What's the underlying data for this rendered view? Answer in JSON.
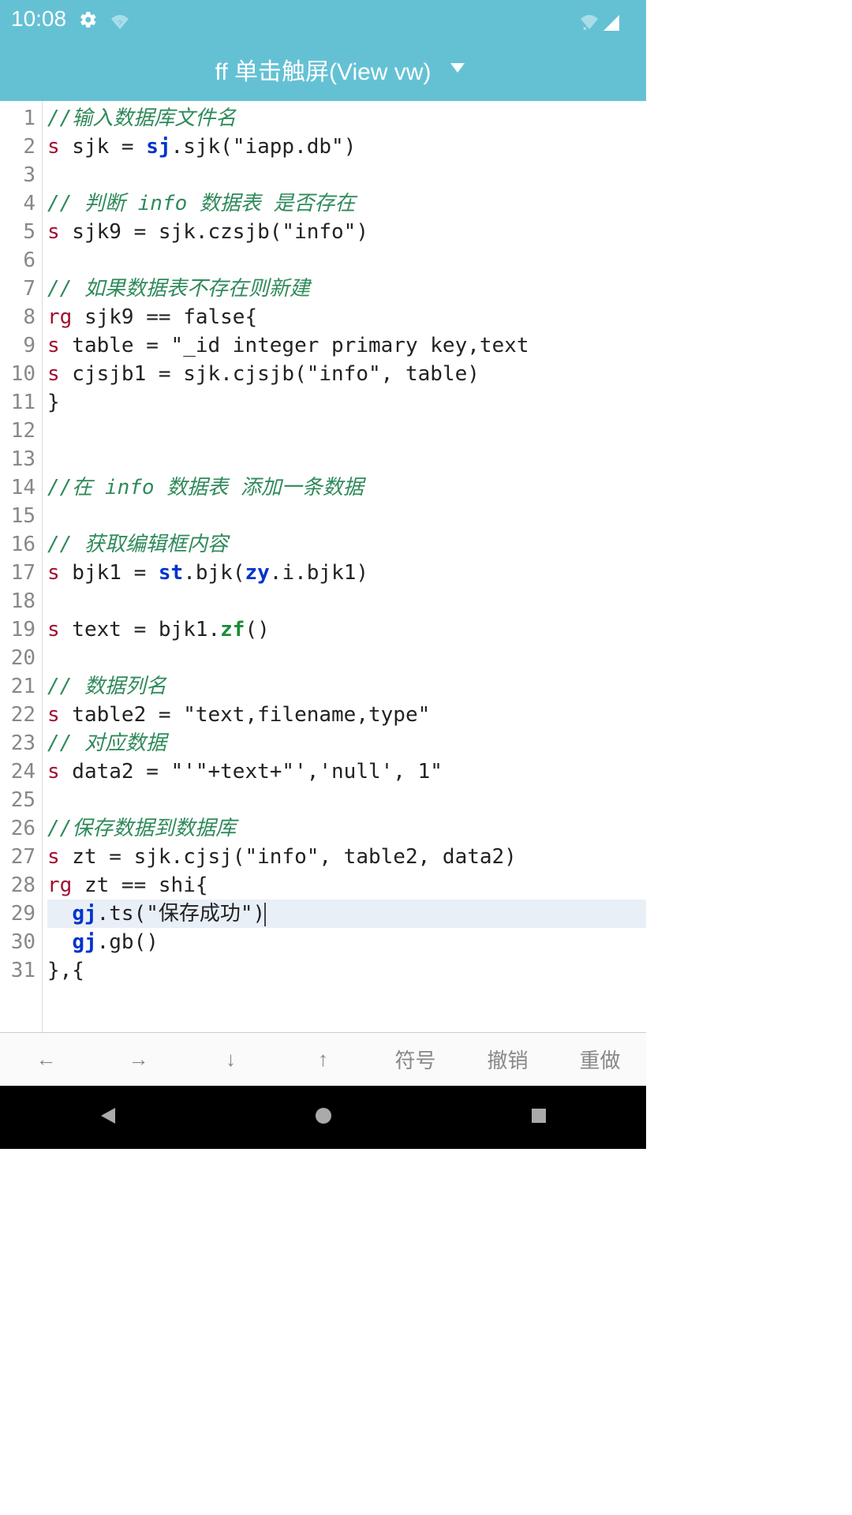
{
  "status": {
    "time": "10:08"
  },
  "header": {
    "title": "ff 单击触屏(View vw)"
  },
  "editor": {
    "lines": [
      {
        "n": "1",
        "segs": [
          {
            "t": "//输入数据库文件名",
            "c": "c-comment"
          }
        ]
      },
      {
        "n": "2",
        "segs": [
          {
            "t": "s",
            "c": "c-keyword"
          },
          {
            "t": " sjk = ",
            "c": "c-text"
          },
          {
            "t": "sj",
            "c": "c-builtin"
          },
          {
            "t": ".sjk(\"iapp.db\")",
            "c": "c-text"
          }
        ]
      },
      {
        "n": "3",
        "segs": []
      },
      {
        "n": "4",
        "segs": [
          {
            "t": "// 判断 info 数据表 是否存在",
            "c": "c-comment"
          }
        ]
      },
      {
        "n": "5",
        "segs": [
          {
            "t": "s",
            "c": "c-keyword"
          },
          {
            "t": " sjk9 = sjk.czsjb(\"info\")",
            "c": "c-text"
          }
        ]
      },
      {
        "n": "6",
        "segs": []
      },
      {
        "n": "7",
        "segs": [
          {
            "t": "// 如果数据表不存在则新建",
            "c": "c-comment"
          }
        ]
      },
      {
        "n": "8",
        "segs": [
          {
            "t": "rg",
            "c": "c-keyword"
          },
          {
            "t": " sjk9 == false{",
            "c": "c-text"
          }
        ]
      },
      {
        "n": "9",
        "segs": [
          {
            "t": "s",
            "c": "c-keyword"
          },
          {
            "t": " table = \"_id integer primary key,text",
            "c": "c-text"
          }
        ]
      },
      {
        "n": "10",
        "segs": [
          {
            "t": "s",
            "c": "c-keyword"
          },
          {
            "t": " cjsjb1 = sjk.cjsjb(\"info\", table)",
            "c": "c-text"
          }
        ]
      },
      {
        "n": "11",
        "segs": [
          {
            "t": "}",
            "c": "c-text"
          }
        ]
      },
      {
        "n": "12",
        "segs": []
      },
      {
        "n": "13",
        "segs": []
      },
      {
        "n": "14",
        "segs": [
          {
            "t": "//在 info 数据表 添加一条数据",
            "c": "c-comment"
          }
        ]
      },
      {
        "n": "15",
        "segs": []
      },
      {
        "n": "16",
        "segs": [
          {
            "t": "// 获取编辑框内容",
            "c": "c-comment"
          }
        ]
      },
      {
        "n": "17",
        "segs": [
          {
            "t": "s",
            "c": "c-keyword"
          },
          {
            "t": " bjk1 = ",
            "c": "c-text"
          },
          {
            "t": "st",
            "c": "c-builtin"
          },
          {
            "t": ".bjk(",
            "c": "c-text"
          },
          {
            "t": "zy",
            "c": "c-builtin"
          },
          {
            "t": ".i.bjk1)",
            "c": "c-text"
          }
        ]
      },
      {
        "n": "18",
        "segs": []
      },
      {
        "n": "19",
        "segs": [
          {
            "t": "s",
            "c": "c-keyword"
          },
          {
            "t": " text = bjk1.",
            "c": "c-text"
          },
          {
            "t": "zf",
            "c": "c-func"
          },
          {
            "t": "()",
            "c": "c-text"
          }
        ]
      },
      {
        "n": "20",
        "segs": []
      },
      {
        "n": "21",
        "segs": [
          {
            "t": "// 数据列名",
            "c": "c-comment"
          }
        ]
      },
      {
        "n": "22",
        "segs": [
          {
            "t": "s",
            "c": "c-keyword"
          },
          {
            "t": " table2 = \"text,filename,type\"",
            "c": "c-text"
          }
        ]
      },
      {
        "n": "23",
        "segs": [
          {
            "t": "// 对应数据",
            "c": "c-comment"
          }
        ]
      },
      {
        "n": "24",
        "segs": [
          {
            "t": "s",
            "c": "c-keyword"
          },
          {
            "t": " data2 = \"'\"+text+\"','null', 1\"",
            "c": "c-text"
          }
        ]
      },
      {
        "n": "25",
        "segs": []
      },
      {
        "n": "26",
        "segs": [
          {
            "t": "//保存数据到数据库",
            "c": "c-comment"
          }
        ]
      },
      {
        "n": "27",
        "segs": [
          {
            "t": "s",
            "c": "c-keyword"
          },
          {
            "t": " zt = sjk.cjsj(\"info\", table2, data2)",
            "c": "c-text"
          }
        ]
      },
      {
        "n": "28",
        "segs": [
          {
            "t": "rg",
            "c": "c-keyword"
          },
          {
            "t": " zt == shi{",
            "c": "c-text"
          }
        ]
      },
      {
        "n": "29",
        "hl": true,
        "segs": [
          {
            "t": "  ",
            "c": "c-text"
          },
          {
            "t": "gj",
            "c": "c-builtin"
          },
          {
            "t": ".ts(\"保存成功\")",
            "c": "c-text"
          }
        ],
        "cursor": true
      },
      {
        "n": "30",
        "segs": [
          {
            "t": "  ",
            "c": "c-text"
          },
          {
            "t": "gj",
            "c": "c-builtin"
          },
          {
            "t": ".gb()",
            "c": "c-text"
          }
        ]
      },
      {
        "n": "31",
        "segs": [
          {
            "t": "},{",
            "c": "c-text"
          }
        ]
      }
    ]
  },
  "toolbar": {
    "left": "←",
    "right": "→",
    "down": "↓",
    "up": "↑",
    "symbol": "符号",
    "undo": "撤销",
    "redo": "重做"
  }
}
